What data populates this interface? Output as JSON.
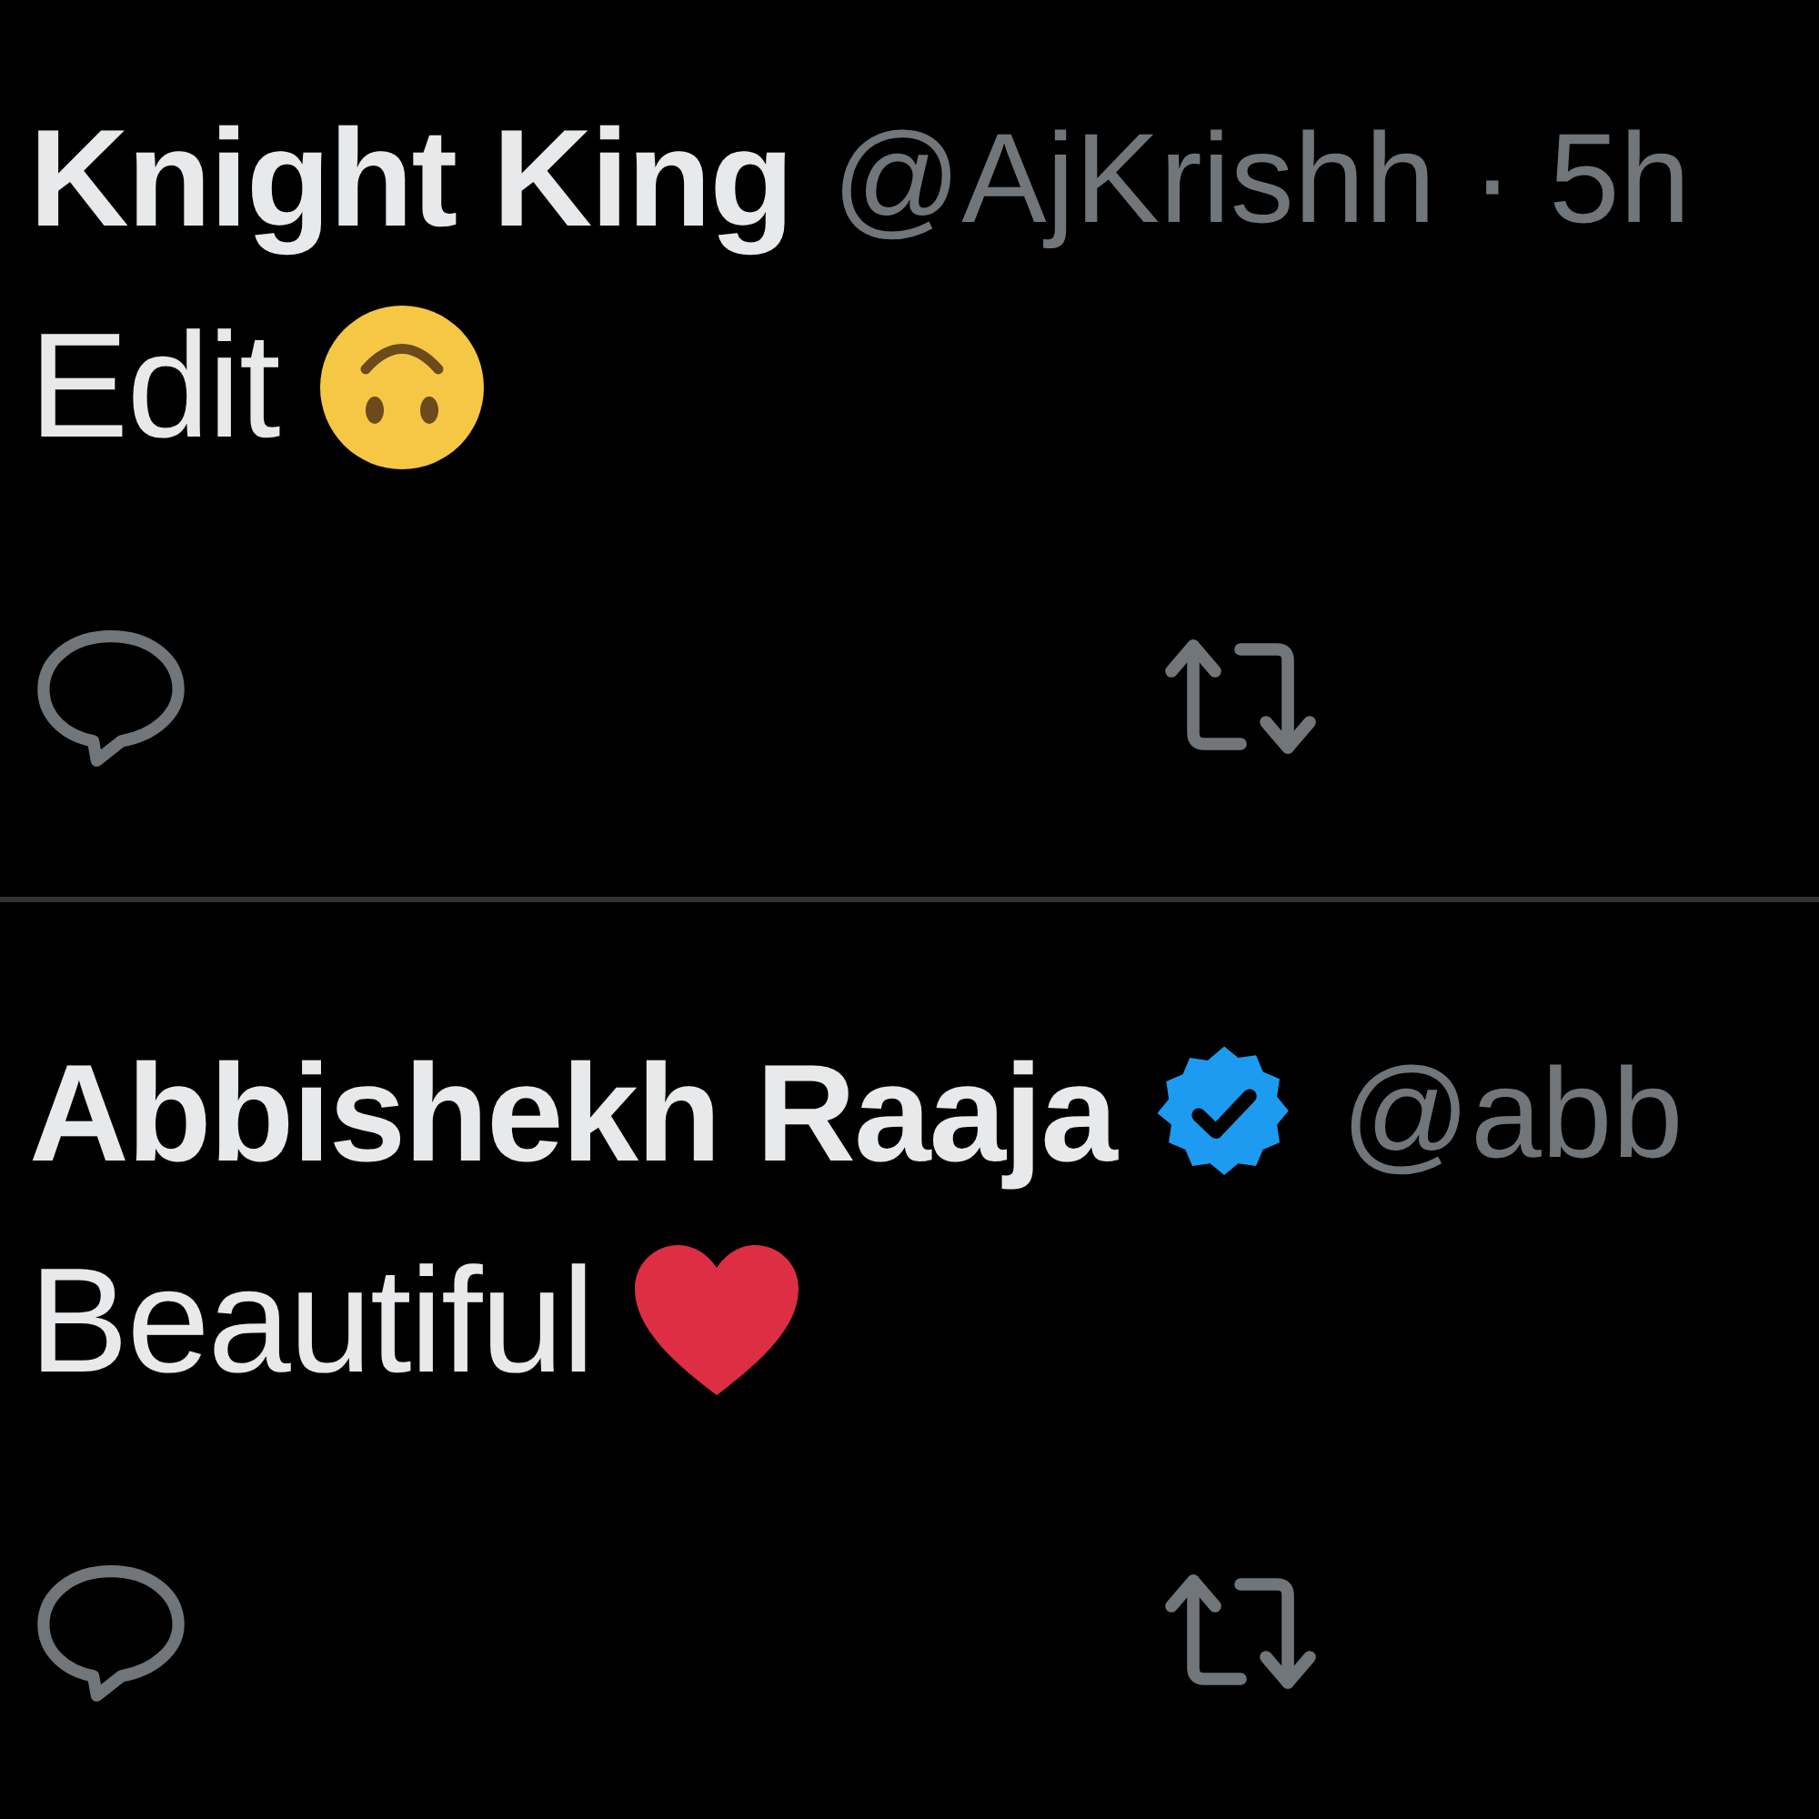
{
  "tweets": [
    {
      "name": "Knight King",
      "verified": false,
      "handle": "@AjKrishh · 5h",
      "text": "Edit",
      "reaction": {
        "kind": "upside-down-face"
      }
    },
    {
      "name": "Abbishekh Raaja",
      "verified": true,
      "handle": "@abb",
      "text": "Beautiful",
      "reaction": {
        "kind": "heart"
      }
    }
  ]
}
